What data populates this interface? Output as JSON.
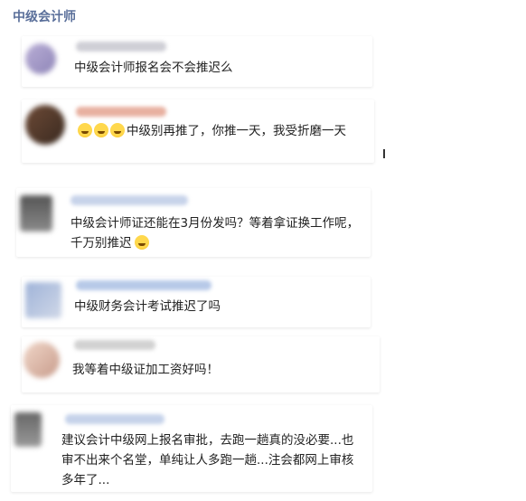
{
  "header": {
    "title": "中级会计师"
  },
  "comments": [
    {
      "text": "中级会计师报名会不会推迟么",
      "emoji_prefix": 0,
      "emoji_suffix": 0
    },
    {
      "text": "中级别再推了，你推一天，我受折磨一天",
      "emoji_prefix": 3,
      "emoji_suffix": 0,
      "emoji_icon": "laughing-crying-emoji-icon"
    },
    {
      "text": "中级会计师证还能在3月份发吗？等着拿证换工作呢，千万别推迟",
      "emoji_prefix": 0,
      "emoji_suffix": 1,
      "emoji_icon": "crying-emoji-icon"
    },
    {
      "text": "中级财务会计考试推迟了吗",
      "emoji_prefix": 0,
      "emoji_suffix": 0
    },
    {
      "text": "我等着中级证加工资好吗！",
      "emoji_prefix": 0,
      "emoji_suffix": 0
    },
    {
      "text": "建议会计中级网上报名审批，去跑一趟真的没必要...也审不出来个名堂，单纯让人多跑一趟...注会都网上审核多年了...",
      "emoji_prefix": 0,
      "emoji_suffix": 0
    }
  ],
  "colors": {
    "title": "#5a6f9a",
    "text": "#222222"
  }
}
